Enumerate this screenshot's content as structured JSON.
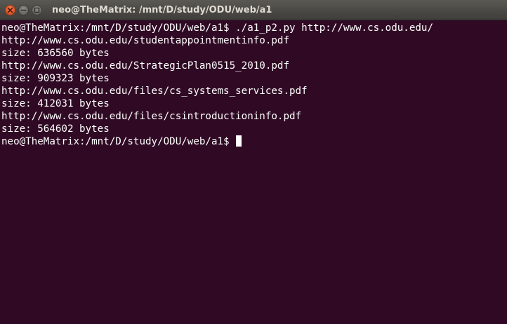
{
  "window": {
    "title": "neo@TheMatrix: /mnt/D/study/ODU/web/a1",
    "controls": {
      "close_icon": "close-icon",
      "minimize_icon": "minimize-icon",
      "maximize_icon": "maximize-icon"
    }
  },
  "terminal": {
    "background": "#300a24",
    "foreground": "#ffffff",
    "lines": [
      "neo@TheMatrix:/mnt/D/study/ODU/web/a1$ ./a1_p2.py http://www.cs.odu.edu/",
      "http://www.cs.odu.edu/studentappointmentinfo.pdf",
      "size: 636560 bytes",
      "http://www.cs.odu.edu/StrategicPlan0515_2010.pdf",
      "size: 909323 bytes",
      "http://www.cs.odu.edu/files/cs_systems_services.pdf",
      "size: 412031 bytes",
      "http://www.cs.odu.edu/files/csintroductioninfo.pdf",
      "size: 564602 bytes"
    ],
    "prompt": "neo@TheMatrix:/mnt/D/study/ODU/web/a1$ "
  }
}
